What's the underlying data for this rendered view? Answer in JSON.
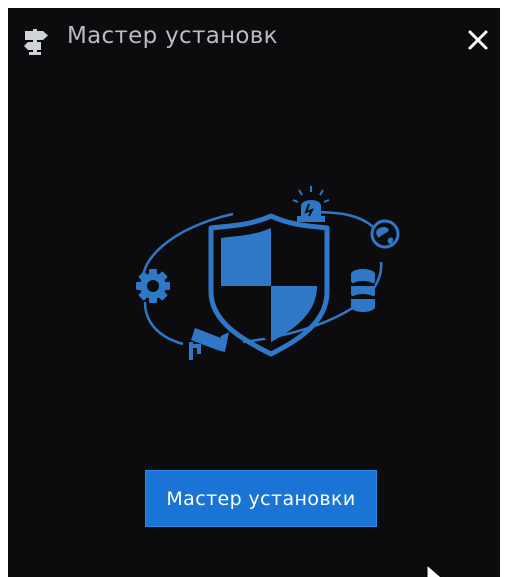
{
  "window": {
    "title": "Мастер установк",
    "title_icon": "signpost-icon",
    "close_icon": "close-icon"
  },
  "illustration": {
    "icons": [
      "shield-icon",
      "alarm-siren-icon",
      "globe-icon",
      "database-icon",
      "gear-icon",
      "camera-icon"
    ],
    "accent_color": "#2f77c7"
  },
  "actions": {
    "start_wizard_label": "Мастер установки"
  },
  "colors": {
    "background": "#0c0c0e",
    "title_text": "#b9bcc2",
    "primary_button": "#1a74d6"
  }
}
